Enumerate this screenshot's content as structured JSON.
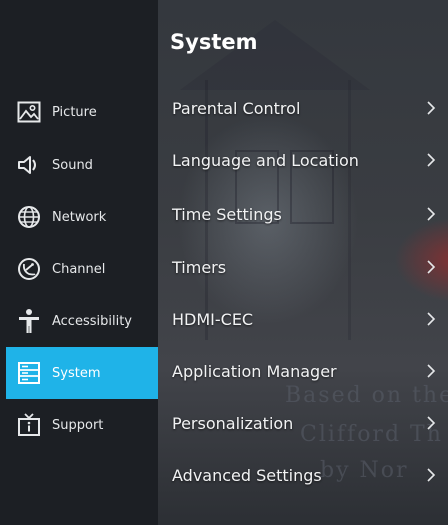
{
  "menu": {
    "title": "System",
    "items": [
      {
        "label": "Parental Control"
      },
      {
        "label": "Language and Location"
      },
      {
        "label": "Time Settings"
      },
      {
        "label": "Timers"
      },
      {
        "label": "HDMI-CEC"
      },
      {
        "label": "Application Manager"
      },
      {
        "label": "Personalization"
      },
      {
        "label": "Advanced Settings"
      }
    ]
  },
  "sidebar": {
    "items": [
      {
        "label": "Picture",
        "icon": "picture-icon"
      },
      {
        "label": "Sound",
        "icon": "speaker-icon"
      },
      {
        "label": "Network",
        "icon": "globe-icon"
      },
      {
        "label": "Channel",
        "icon": "satellite-dish-icon"
      },
      {
        "label": "Accessibility",
        "icon": "person-icon"
      },
      {
        "label": "System",
        "icon": "server-icon",
        "selected": true
      },
      {
        "label": "Support",
        "icon": "tv-info-icon"
      }
    ]
  },
  "background_text": {
    "line1": "Based on the Sc",
    "line2": "Clifford Th",
    "line3": "by Nor"
  },
  "colors": {
    "accent": "#1fb3e8",
    "sidebar_bg": "#1c1f24",
    "text": "#f2f3f4"
  }
}
